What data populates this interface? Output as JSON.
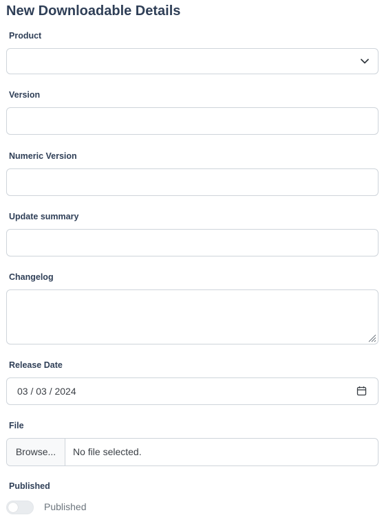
{
  "page": {
    "title": "New Downloadable Details"
  },
  "form": {
    "product": {
      "label": "Product",
      "value": ""
    },
    "version": {
      "label": "Version",
      "value": ""
    },
    "numeric_version": {
      "label": "Numeric Version",
      "value": ""
    },
    "update_summary": {
      "label": "Update summary",
      "value": ""
    },
    "changelog": {
      "label": "Changelog",
      "value": ""
    },
    "release_date": {
      "label": "Release Date",
      "value": "03 / 03 / 2024"
    },
    "file": {
      "label": "File",
      "browse_label": "Browse...",
      "status": "No file selected."
    },
    "published": {
      "label": "Published",
      "toggle_label": "Published",
      "checked": false
    }
  },
  "icons": {
    "product_dropdown": "chevron-down-icon",
    "release_date": "calendar-icon",
    "changelog_resize": "resize-handle-icon"
  },
  "colors": {
    "heading": "#2f3f57",
    "border": "#ced4da",
    "muted_text": "#6c757d"
  }
}
